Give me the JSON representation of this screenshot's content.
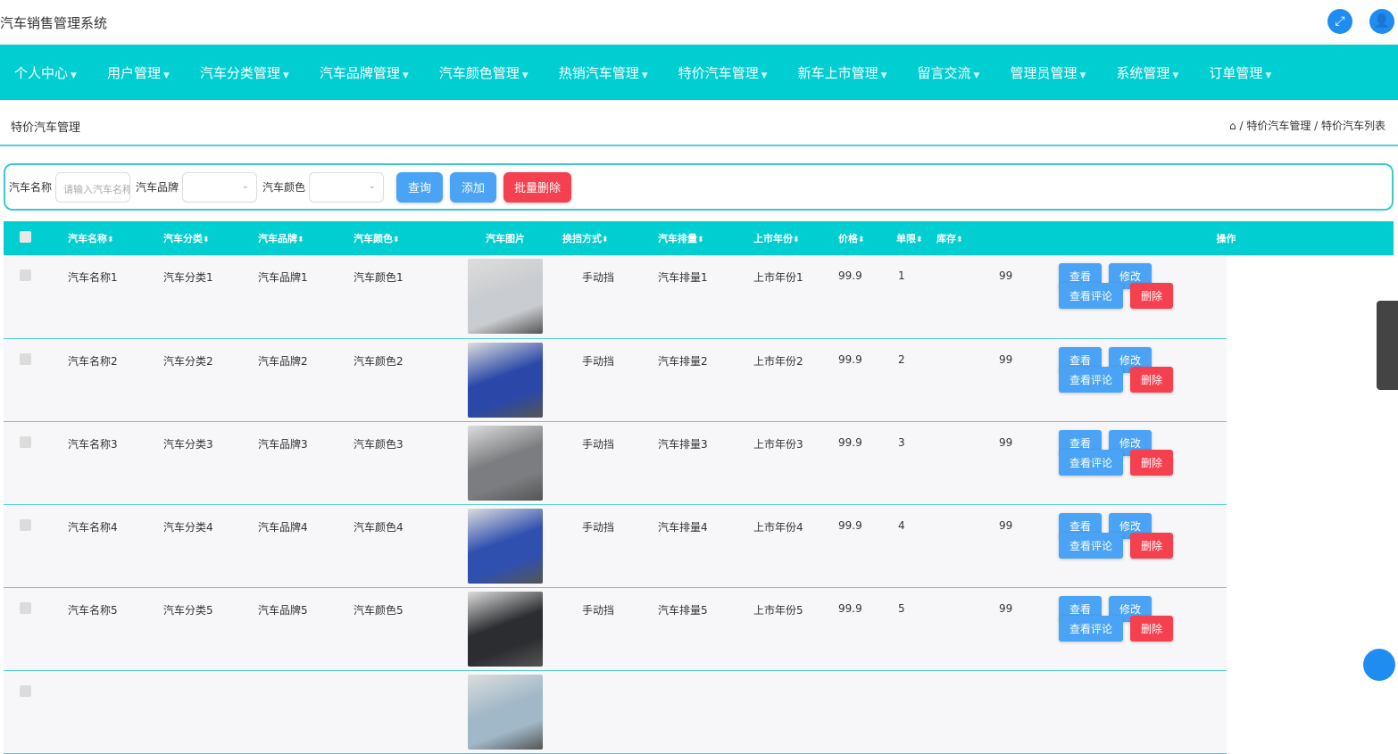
{
  "app_title": "汽车销售管理系统",
  "nav": [
    "个人中心",
    "用户管理",
    "汽车分类管理",
    "汽车品牌管理",
    "汽车颜色管理",
    "热销汽车管理",
    "特价汽车管理",
    "新车上市管理",
    "留言交流",
    "管理员管理",
    "系统管理",
    "订单管理"
  ],
  "page_title": "特价汽车管理",
  "breadcrumb": {
    "home_icon": "⌂",
    "text": "/ 特价汽车管理 / 特价汽车列表"
  },
  "search": {
    "name_label": "汽车名称",
    "name_placeholder": "请输入汽车名称",
    "brand_label": "汽车品牌",
    "color_label": "汽车颜色",
    "query": "查询",
    "add": "添加",
    "batch_delete": "批量删除"
  },
  "columns": [
    "汽车名称",
    "汽车分类",
    "汽车品牌",
    "汽车颜色",
    "汽车图片",
    "换挡方式",
    "汽车排量",
    "上市年份",
    "价格",
    "单限",
    "库存",
    "操作"
  ],
  "sort_icon": "⬍",
  "actions": {
    "view": "查看",
    "edit": "修改",
    "comments": "查看评论",
    "delete": "删除"
  },
  "rows": [
    {
      "name": "汽车名称1",
      "category": "汽车分类1",
      "brand": "汽车品牌1",
      "color": "汽车颜色1",
      "shift": "手动挡",
      "displacement": "汽车排量1",
      "year": "上市年份1",
      "price": "99.9",
      "limit": "1",
      "stock": "99",
      "img": "#c9ccd0"
    },
    {
      "name": "汽车名称2",
      "category": "汽车分类2",
      "brand": "汽车品牌2",
      "color": "汽车颜色2",
      "shift": "手动挡",
      "displacement": "汽车排量2",
      "year": "上市年份2",
      "price": "99.9",
      "limit": "2",
      "stock": "99",
      "img": "#2a48a8"
    },
    {
      "name": "汽车名称3",
      "category": "汽车分类3",
      "brand": "汽车品牌3",
      "color": "汽车颜色3",
      "shift": "手动挡",
      "displacement": "汽车排量3",
      "year": "上市年份3",
      "price": "99.9",
      "limit": "3",
      "stock": "99",
      "img": "#7b7d80"
    },
    {
      "name": "汽车名称4",
      "category": "汽车分类4",
      "brand": "汽车品牌4",
      "color": "汽车颜色4",
      "shift": "手动挡",
      "displacement": "汽车排量4",
      "year": "上市年份4",
      "price": "99.9",
      "limit": "4",
      "stock": "99",
      "img": "#3050b0"
    },
    {
      "name": "汽车名称5",
      "category": "汽车分类5",
      "brand": "汽车品牌5",
      "color": "汽车颜色5",
      "shift": "手动挡",
      "displacement": "汽车排量5",
      "year": "上市年份5",
      "price": "99.9",
      "limit": "5",
      "stock": "99",
      "img": "#2b2d30"
    },
    {
      "name": "",
      "category": "",
      "brand": "",
      "color": "",
      "shift": "",
      "displacement": "",
      "year": "",
      "price": "",
      "limit": "",
      "stock": "",
      "img": "#a0b8c8"
    }
  ]
}
